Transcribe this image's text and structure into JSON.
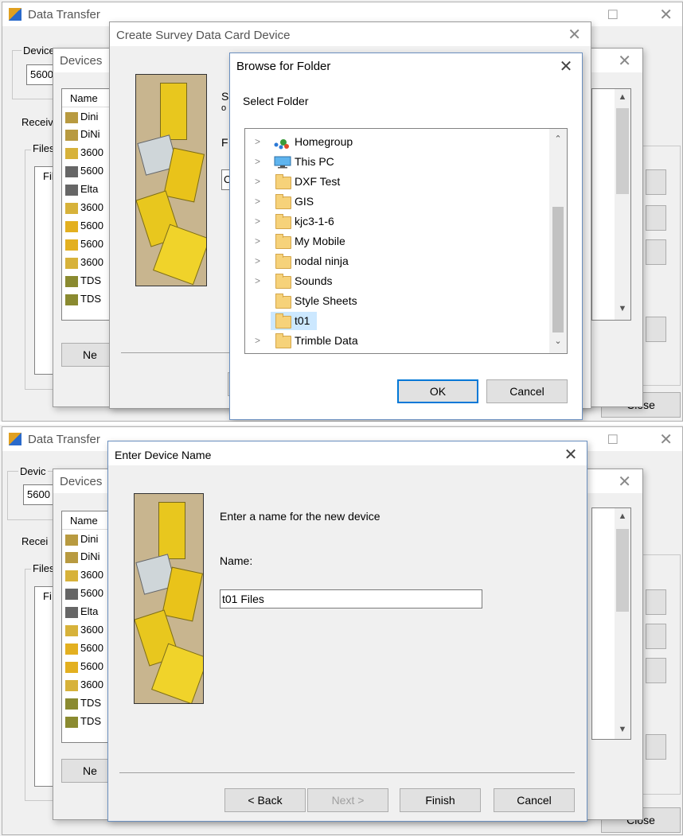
{
  "panel1": {
    "main": {
      "title": "Data Transfer",
      "device_group": "Device",
      "device_value": "5600",
      "receive_label": "Receiv",
      "files_group": "Files",
      "file_col": "Fil",
      "close": "Close"
    },
    "devices": {
      "title": "Devices",
      "name_col": "Name",
      "items": [
        "Dini",
        "DiNi",
        "3600",
        "5600",
        "Elta",
        "3600",
        "5600",
        "5600",
        "3600",
        "TDS",
        "TDS"
      ],
      "new_btn": "Ne"
    },
    "survey": {
      "title": "Create Survey Data Card Device",
      "text_s": "S",
      "text_o": "o",
      "label_f": "F",
      "field": "C"
    },
    "browse": {
      "title": "Browse for Folder",
      "prompt": "Select Folder",
      "items": [
        "Homegroup",
        "This PC",
        "DXF Test",
        "GIS",
        "kjc3-1-6",
        "My Mobile",
        "nodal ninja",
        "Sounds",
        "Style Sheets",
        "t01",
        "Trimble Data"
      ],
      "selected": "t01",
      "ok": "OK",
      "cancel": "Cancel"
    }
  },
  "panel2": {
    "main": {
      "title": "Data Transfer",
      "device_group": "Devic",
      "device_value": "5600",
      "receive_label": "Recei",
      "files_group": "Files",
      "file_col": "Fi",
      "close": "Close"
    },
    "devices": {
      "title": "Devices",
      "name_col": "Name",
      "items": [
        "Dini",
        "DiNi",
        "3600",
        "5600",
        "Elta",
        "3600",
        "5600",
        "5600",
        "3600",
        "TDS",
        "TDS"
      ],
      "new_btn": "Ne"
    },
    "enter": {
      "title": "Enter Device Name",
      "prompt": "Enter a name for the new device",
      "name_label": "Name:",
      "name_value": "t01 Files",
      "back": "< Back",
      "next": "Next >",
      "finish": "Finish",
      "cancel": "Cancel"
    }
  }
}
